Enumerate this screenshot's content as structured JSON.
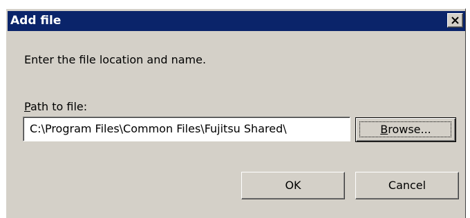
{
  "window": {
    "title": "Add file",
    "close_icon": "close-icon"
  },
  "content": {
    "instruction": "Enter the file location and name.",
    "path_label_mnemonic": "P",
    "path_label_rest": "ath to file:",
    "path_value": "C:\\Program Files\\Common Files\\Fujitsu Shared\\"
  },
  "buttons": {
    "browse_mnemonic": "B",
    "browse_rest": "rowse...",
    "ok": "OK",
    "cancel": "Cancel"
  },
  "colors": {
    "titlebar": "#0a246a",
    "dialog_bg": "#d4d0c8"
  }
}
